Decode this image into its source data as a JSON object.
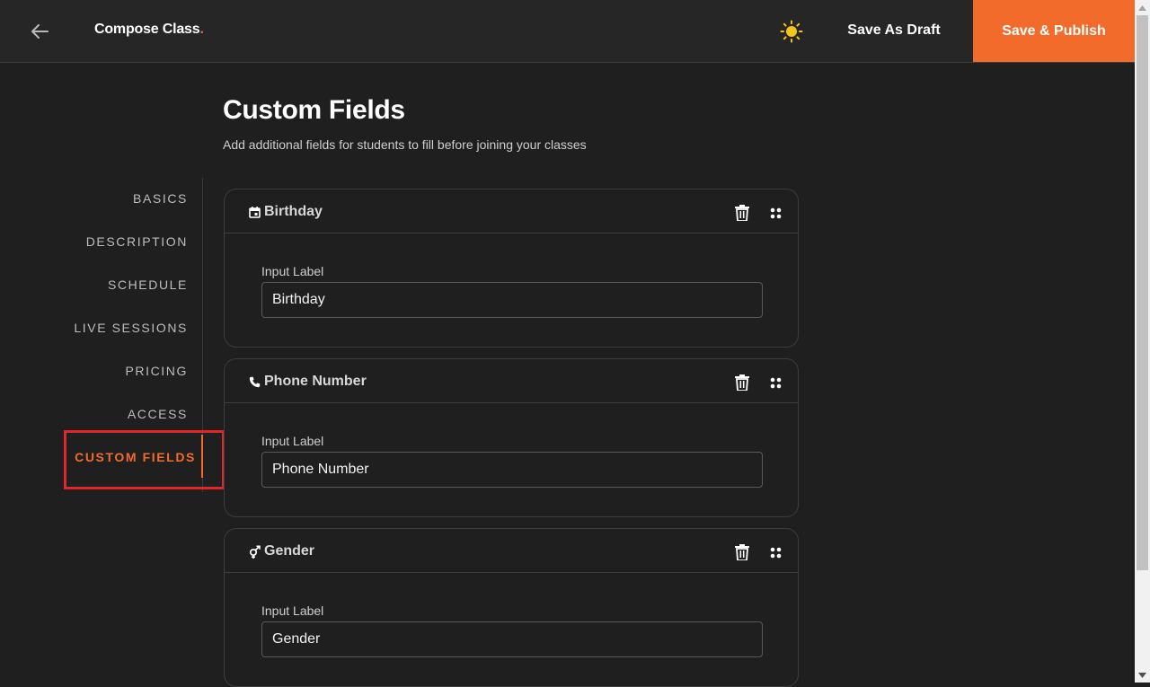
{
  "header": {
    "title": "Compose Class",
    "title_dot": ".",
    "save_draft_label": "Save As Draft",
    "save_publish_label": "Save & Publish",
    "accent_color": "#f26b2a"
  },
  "page": {
    "title": "Custom Fields",
    "subtitle": "Add additional fields for students to fill before joining your classes"
  },
  "sidebar": {
    "items": [
      {
        "label": "BASICS"
      },
      {
        "label": "DESCRIPTION"
      },
      {
        "label": "SCHEDULE"
      },
      {
        "label": "LIVE SESSIONS"
      },
      {
        "label": "PRICING"
      },
      {
        "label": "ACCESS"
      },
      {
        "label": "CUSTOM FIELDS",
        "active": true
      }
    ]
  },
  "fields": [
    {
      "title": "Birthday",
      "icon": "calendar-icon",
      "input_label": "Input Label",
      "value": "Birthday"
    },
    {
      "title": "Phone Number",
      "icon": "phone-icon",
      "input_label": "Input Label",
      "value": "Phone Number"
    },
    {
      "title": "Gender",
      "icon": "gender-icon",
      "input_label": "Input Label",
      "value": "Gender"
    }
  ]
}
